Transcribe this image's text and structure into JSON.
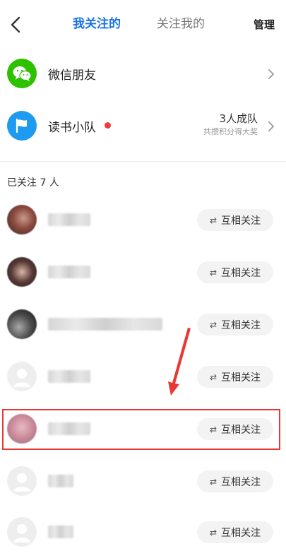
{
  "header": {
    "tab_following": "我关注的",
    "tab_followers": "关注我的",
    "manage_label": "管理"
  },
  "entries": {
    "wechat_friends": "微信朋友",
    "reading_squad": "读书小队",
    "squad_count": "3人成队",
    "squad_hint": "共攒积分得大奖"
  },
  "follow_count_label": "已关注 7 人",
  "follow_list": {
    "button_label": "互相关注",
    "button_icon": "⇄"
  },
  "colors": {
    "accent": "#1a73e8",
    "wechat_green": "#2dc100",
    "squad_blue": "#1e9bf0",
    "highlight_red": "#e53935"
  }
}
